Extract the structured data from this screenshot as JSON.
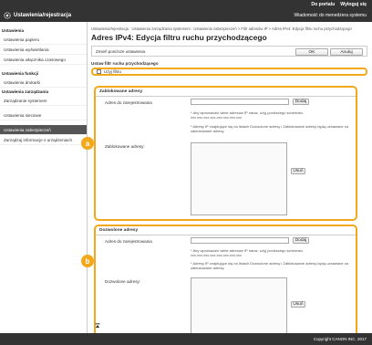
{
  "header": {
    "app_title": "Ustawienia/rejestracja",
    "links": [
      "Do portalu",
      "Wyloguj się"
    ],
    "admin_label": "Wiadomość do menedżera systemu"
  },
  "sidebar": {
    "items": [
      {
        "type": "head",
        "label": "Ustawienia"
      },
      {
        "type": "item",
        "label": "Ustawienia papieru"
      },
      {
        "type": "item",
        "label": "Ustawienia wyświetlania"
      },
      {
        "type": "item",
        "label": "Ustawienia włącznika czasowego"
      },
      {
        "type": "head",
        "label": "Ustawienia funkcji"
      },
      {
        "type": "item",
        "label": "Ustawienia drukarki"
      },
      {
        "type": "head",
        "label": "Ustawienia zarządzania"
      },
      {
        "type": "item",
        "label": "Zarządzanie systemem"
      },
      {
        "type": "item",
        "label": "Ustawienia sieciowe"
      },
      {
        "type": "item",
        "label": "Ustawienia zabezpieczeń",
        "active": true
      },
      {
        "type": "item",
        "label": "Zarządzaj informacje o urządzeniach"
      }
    ]
  },
  "main": {
    "breadcrumb": "Ustawienia/rejestracja : Ustawienia zarządzania systemem : Ustawienia zabezpieczeń > Filtr adresów IP > Adres IPv4: Edycja filtru ruchu przychodzącego",
    "title": "Adres IPv4: Edycja filtru ruchu przychodzącego",
    "action_hint": "Zmień poniższe ustawienia.",
    "ok_label": "OK",
    "cancel_label": "Anuluj",
    "filter_section_label": "Ustaw filtr ruchu przychodzącego",
    "use_filter_label": "Użyj filtru",
    "blocked": {
      "title": "Zablokowane adresy",
      "address_label": "Adres do zarejestrowania",
      "add_label": "Dodaj",
      "note1": "* Aby wprowadzić wiele adresów IP naraz, użyj poniższego schematu.",
      "note1b": "xxx.xxx.xxx.xxx-xxx.xxx.xxx.xxx",
      "note2": "* Adresy IP znajdujące się na listach Dozwolone adresy i Zablokowane adresy będą uznawane za zablokowane adresy.",
      "list_label": "Zablokowane adresy:",
      "delete_label": "Usuń"
    },
    "allowed": {
      "title": "Dozwolone adresy",
      "address_label": "Adres do zarejestrowania",
      "add_label": "Dodaj",
      "note1": "* Aby wprowadzić wiele adresów IP naraz, użyj poniższego schematu.",
      "note1b": "xxx.xxx.xxx.xxx-xxx.xxx.xxx.xxx",
      "note2": "* Adresy IP znajdujące się na listach Dozwolone adresy i Zablokowane adresy będą uznawane za zablokowane adresy.",
      "list_label": "Dozwolone adresy:",
      "delete_label": "Usuń"
    },
    "badges": [
      "a",
      "b"
    ]
  },
  "footer": {
    "copyright": "Copyright CANON INC. 2017"
  },
  "colors": {
    "accent": "#f3a81b",
    "topbar": "#333333",
    "active_item": "#555555"
  }
}
